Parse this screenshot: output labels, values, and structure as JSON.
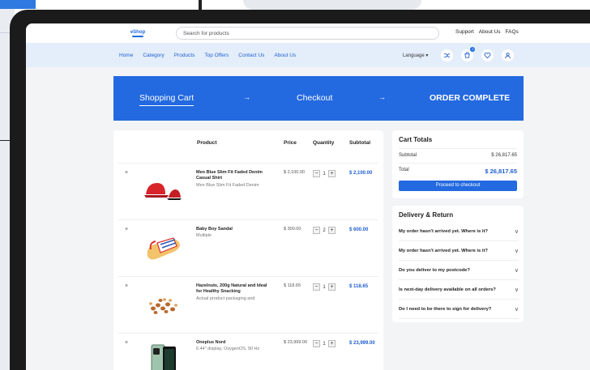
{
  "header": {
    "logo_text": "eShop",
    "search_placeholder": "Search for products",
    "links": [
      "Support",
      "About Us",
      "FAQs"
    ]
  },
  "nav": {
    "items": [
      "Home",
      "Category",
      "Products",
      "Top Offers",
      "Contact Us",
      "About Us"
    ],
    "language": "Language ▾",
    "icons": [
      "shuffle-icon",
      "cart-icon",
      "heart-icon",
      "user-icon"
    ],
    "cart_badge": "2"
  },
  "steps": {
    "step1": "Shopping Cart",
    "step2": "Checkout",
    "step3": "ORDER COMPLETE",
    "arrow": "→"
  },
  "cart": {
    "columns": [
      "Product",
      "Price",
      "Quantity",
      "Subtotal"
    ],
    "remove_label": "×",
    "items": [
      {
        "name": "Men Blue Slim Fit Faded Denim Casual Shirt",
        "desc": "Men Blue Slim Fit Faded Denim",
        "price": "$ 2,100.00",
        "qty": "1",
        "subtotal": "$ 2,100.00"
      },
      {
        "name": "Baby Boy Sandal",
        "desc": "Multiple",
        "price": "$ 300.00",
        "qty": "2",
        "subtotal": "$ 600.00"
      },
      {
        "name": "Hazelnuts, 200g Natural and Ideal for Healthy Snacking",
        "desc": "Actual product packaging and",
        "price": "$ 118.65",
        "qty": "1",
        "subtotal": "$ 118.65"
      },
      {
        "name": "Oneplus Nord",
        "desc": "6.44\" display, OxygenOS, 90 Hz",
        "price": "$ 23,999.00",
        "qty": "1",
        "subtotal": "$ 23,999.00"
      }
    ]
  },
  "totals": {
    "title": "Cart Totals",
    "subtotal_label": "Subtotal",
    "subtotal_value": "$ 26,817.65",
    "total_label": "Total",
    "total_value": "$ 26,817.65",
    "checkout_label": "Proceed to checkout"
  },
  "delivery": {
    "title": "Delivery & Return",
    "questions": [
      "My order hasn't arrived yet. Where is it?",
      "My order hasn't arrived yet. Where is it?",
      "Do you deliver to my postcode?",
      "Is next-day delivery available on all orders?",
      "Do I need to be there to sign for delivery?"
    ]
  },
  "colors": {
    "primary": "#2369e0",
    "nav_bg": "#e4eefb",
    "price_accent": "#1f5fcf"
  }
}
